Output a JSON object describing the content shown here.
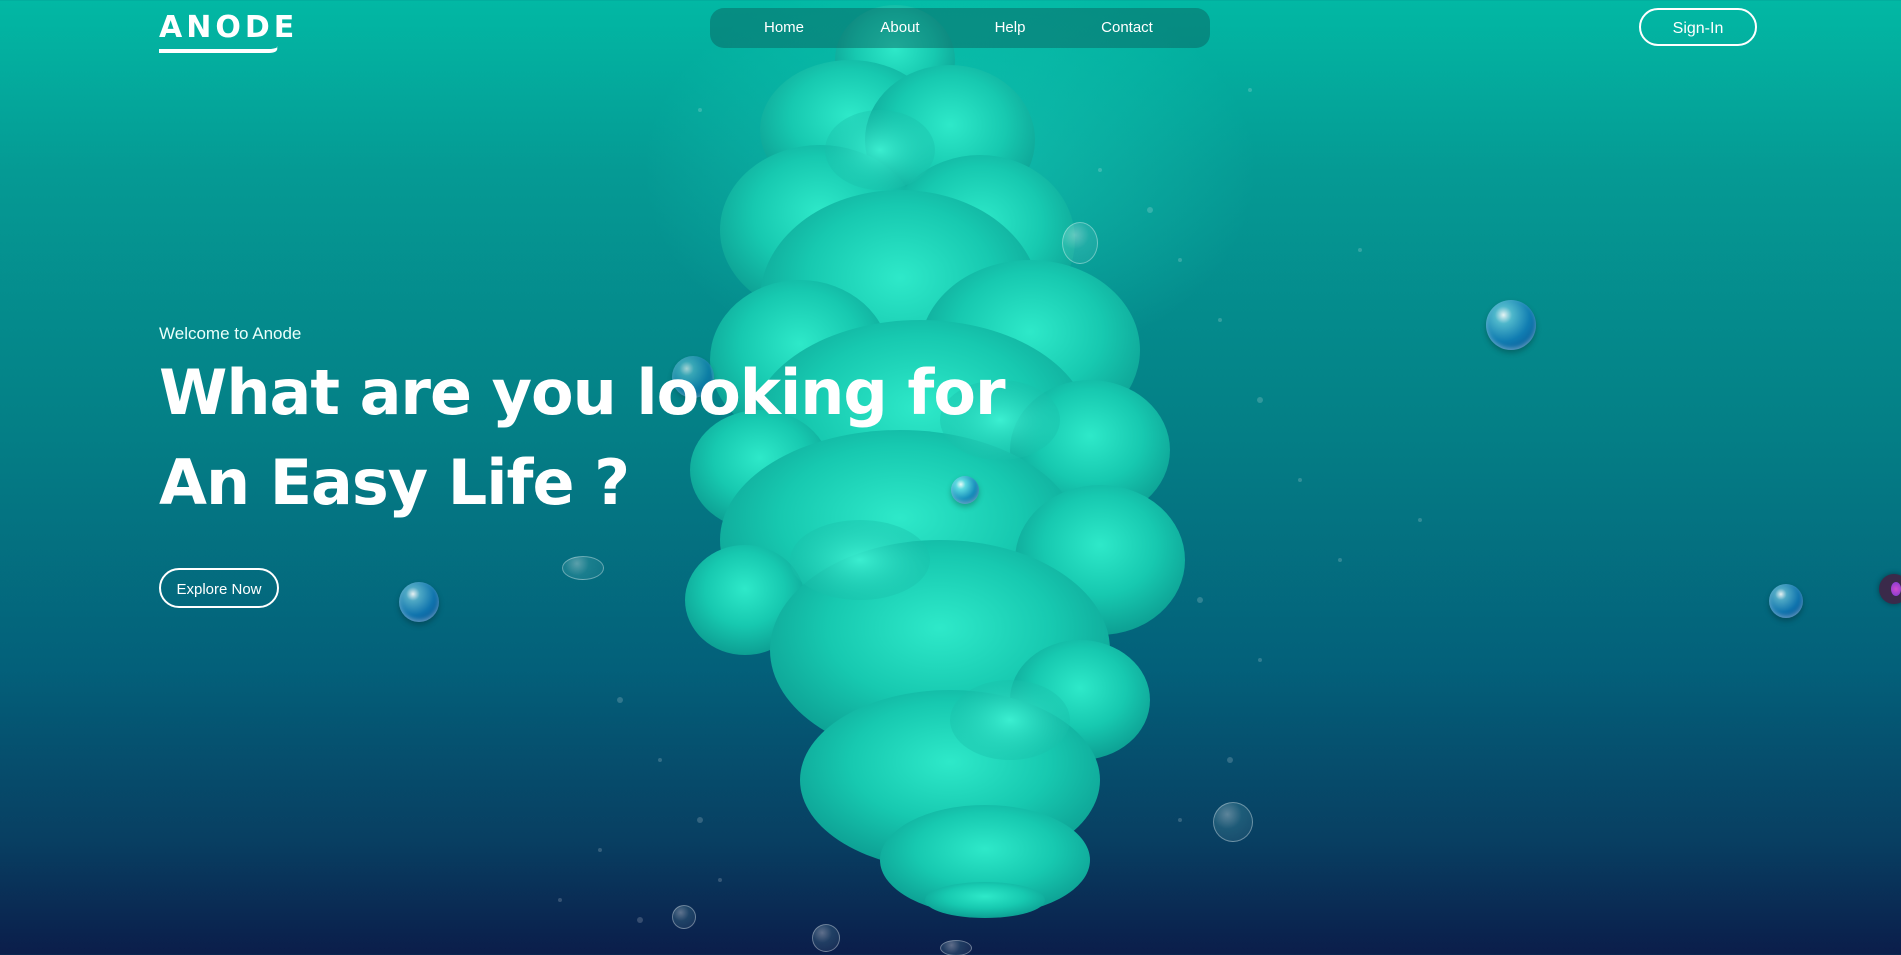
{
  "brand": {
    "logo_text": "ANODE"
  },
  "nav": {
    "items": [
      {
        "label": "Home"
      },
      {
        "label": "About"
      },
      {
        "label": "Help"
      },
      {
        "label": "Contact"
      }
    ]
  },
  "header": {
    "sign_in_label": "Sign-In"
  },
  "hero": {
    "welcome": "Welcome to Anode",
    "headline_line1": "What are you looking for",
    "headline_line2": "An Easy Life ?",
    "cta_label": "Explore Now"
  },
  "colors": {
    "accent_teal": "#02b8a4",
    "deep_navy": "#0b1d4a",
    "text": "#ffffff"
  },
  "icons": {
    "side_widget": "chat-launcher-icon"
  }
}
